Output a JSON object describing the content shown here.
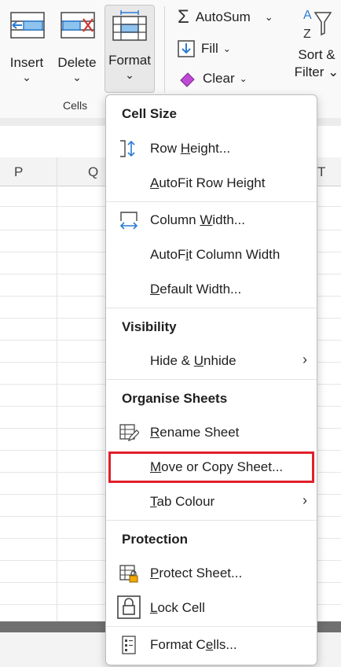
{
  "ribbon": {
    "insert_label": "Insert",
    "delete_label": "Delete",
    "format_label": "Format",
    "chevron": "⌄",
    "group_label": "Cells",
    "autosum_label": "AutoSum",
    "fill_label": "Fill",
    "clear_label": "Clear",
    "sort_label": "Sort &",
    "filter_label": "Filter"
  },
  "sheet": {
    "columns": [
      "P",
      "Q",
      "T"
    ]
  },
  "menu": {
    "cell_size_header": "Cell Size",
    "row_height": {
      "pre": "Row ",
      "ul": "H",
      "post": "eight..."
    },
    "autofit_row": {
      "pre": "",
      "ul": "A",
      "post": "utoFit Row Height"
    },
    "column_width": {
      "pre": "Column ",
      "ul": "W",
      "post": "idth..."
    },
    "autofit_column": {
      "pre": "AutoF",
      "ul": "i",
      "post": "t Column Width"
    },
    "default_width": {
      "pre": "",
      "ul": "D",
      "post": "efault Width..."
    },
    "visibility_header": "Visibility",
    "hide_unhide": {
      "pre": "Hide & ",
      "ul": "U",
      "post": "nhide"
    },
    "organise_header": "Organise Sheets",
    "rename_sheet": {
      "pre": "",
      "ul": "R",
      "post": "ename Sheet"
    },
    "move_copy_sheet": {
      "pre": "",
      "ul": "M",
      "post": "ove or Copy Sheet..."
    },
    "tab_colour": {
      "pre": "",
      "ul": "T",
      "post": "ab Colour"
    },
    "protection_header": "Protection",
    "protect_sheet": {
      "pre": "",
      "ul": "P",
      "post": "rotect Sheet..."
    },
    "lock_cell": {
      "pre": "",
      "ul": "L",
      "post": "ock Cell"
    },
    "format_cells": {
      "pre": "Format C",
      "ul": "e",
      "post": "lls..."
    },
    "submenu_arrow": "›"
  },
  "colors": {
    "highlight": "#e0202a",
    "accent": "#2b7cd3"
  }
}
